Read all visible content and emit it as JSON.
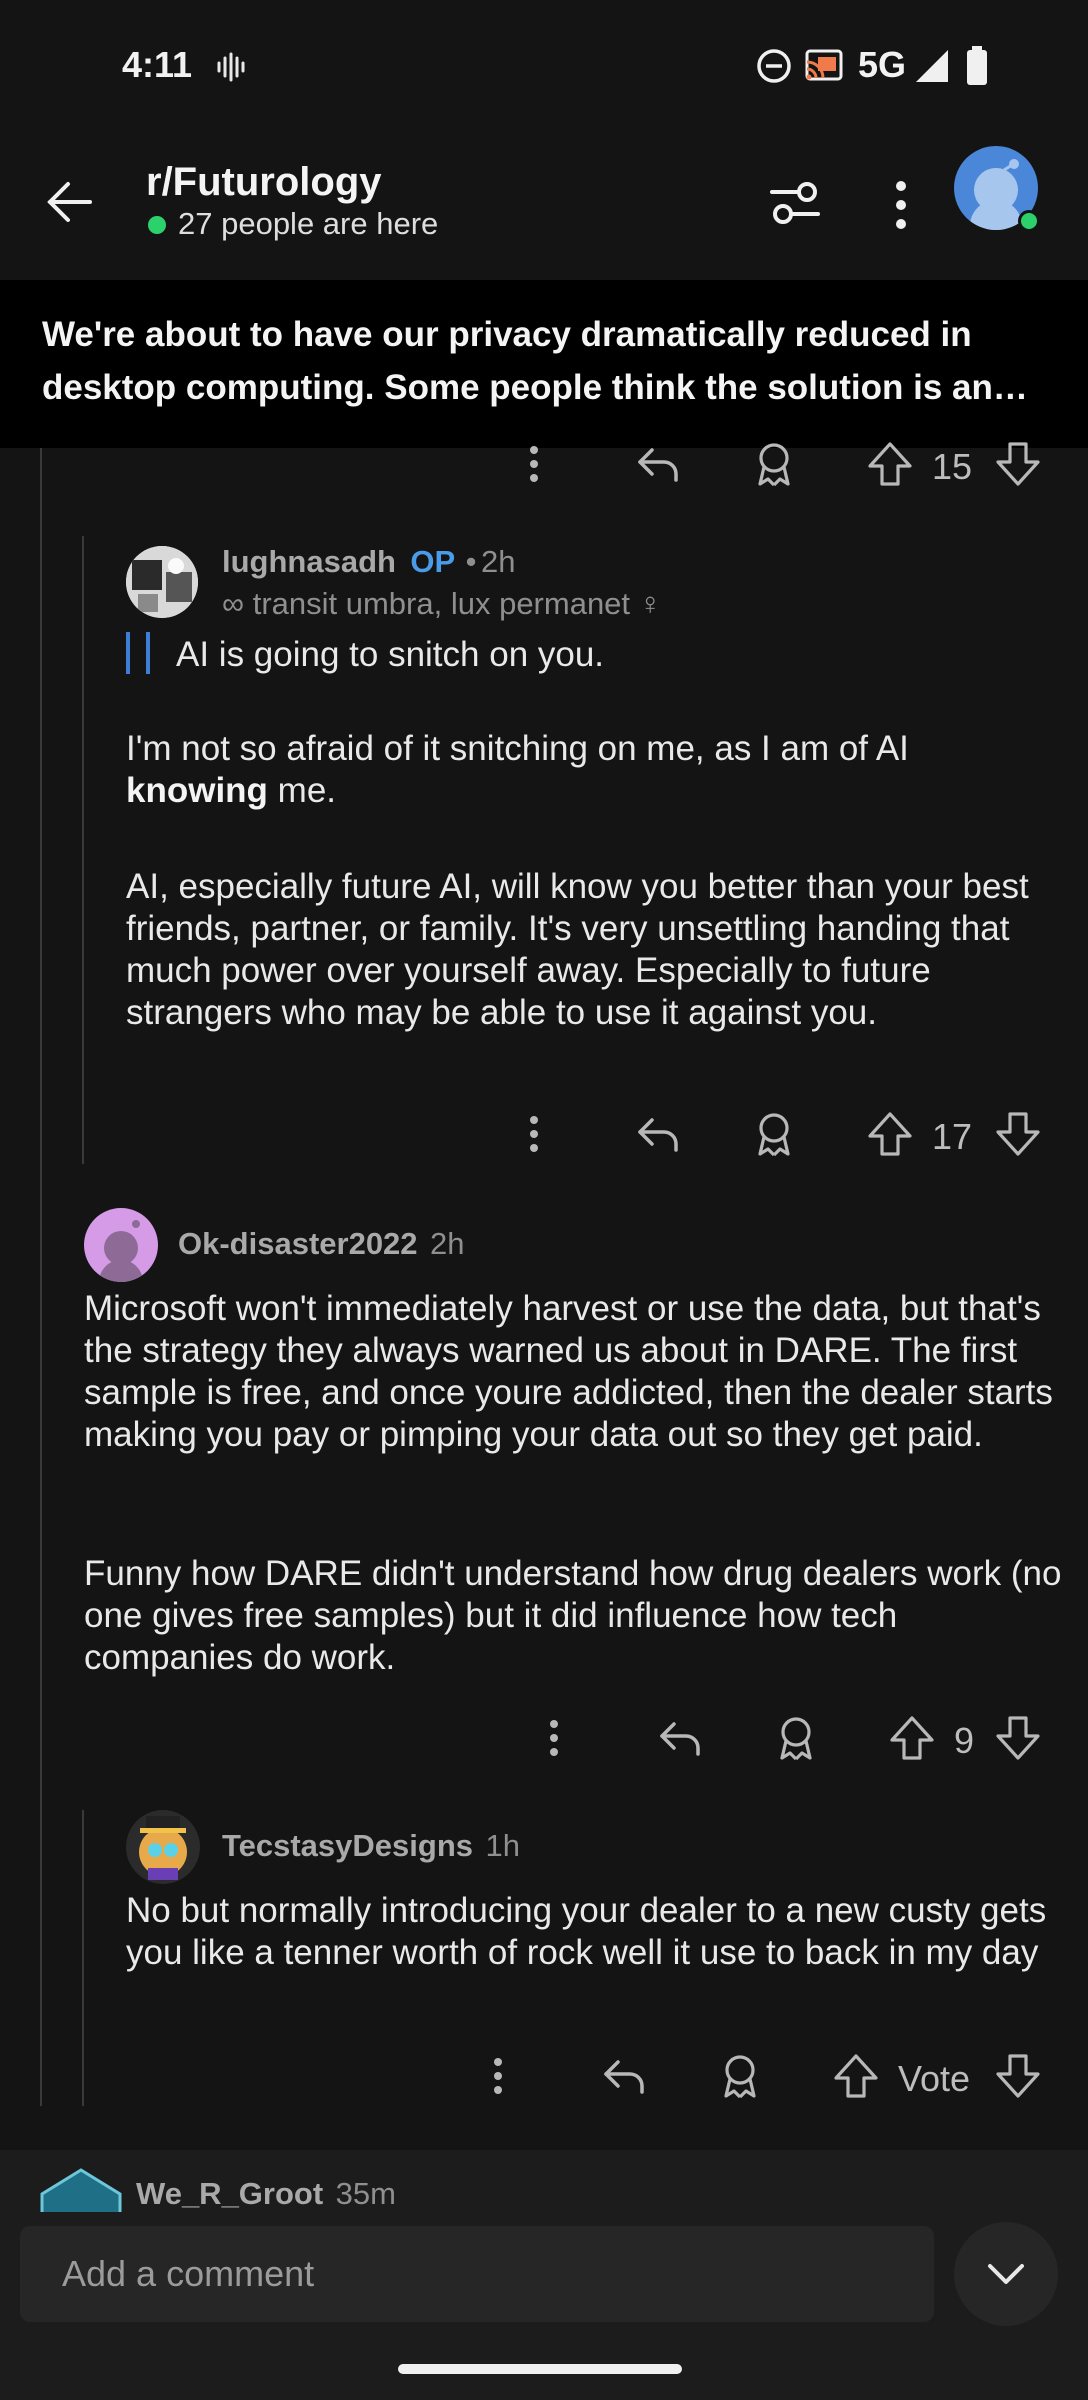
{
  "status_bar": {
    "time": "4:11",
    "network": "5G",
    "icons": [
      "vibrate-icon",
      "dnd-icon",
      "cast-icon",
      "signal-icon",
      "battery-icon"
    ]
  },
  "header": {
    "subreddit": "r/Futurology",
    "online_text": "27 people are here",
    "icons": [
      "back-arrow-icon",
      "filter-icon",
      "more-vertical-icon",
      "avatar"
    ],
    "online_color": "#2bd26b"
  },
  "post": {
    "title": "We're about to have our privacy dramatically reduced in desktop computing. Some people think the solution is an op..."
  },
  "top_actions": {
    "votes": "15"
  },
  "comments": [
    {
      "username": "lughnasadh",
      "op_badge": "OP",
      "separator": "•",
      "time": "2h",
      "flair": "∞ transit umbra, lux permanet ♀",
      "quote": "AI is going to snitch on you.",
      "para1_start": "I'm not so afraid of it snitching on me, as I am of AI",
      "para1_bold": "knowing",
      "para1_end": "me.",
      "para2": "AI, especially future AI, will know you better than your best friends, partner, or family. It's very unsettling handing that much power over yourself away. Especially to future strangers who may be able to use it against you.",
      "votes": "17"
    },
    {
      "username": "Ok-disaster2022",
      "time": "2h",
      "para1": "Microsoft won't immediately harvest or use the data, but that's the strategy they always warned us about in DARE. The first sample is free, and once youre addicted, then the dealer starts making you pay or pimping your data out so they get paid.",
      "para2": "Funny how DARE didn't understand how drug dealers work (no one gives free samples) but it did influence how tech companies do work.",
      "votes": "9"
    },
    {
      "username": "TecstasyDesigns",
      "time": "1h",
      "para1": "No but normally introducing your dealer to a new custy gets you like a tenner worth of rock well it use to back in my day",
      "votes": "Vote"
    },
    {
      "username": "We_R_Groot",
      "time": "35m"
    }
  ],
  "composer": {
    "placeholder": "Add a comment"
  },
  "colors": {
    "background": "#141414",
    "op_badge": "#4a9be8",
    "quote_bar": "#3d7fd6"
  }
}
